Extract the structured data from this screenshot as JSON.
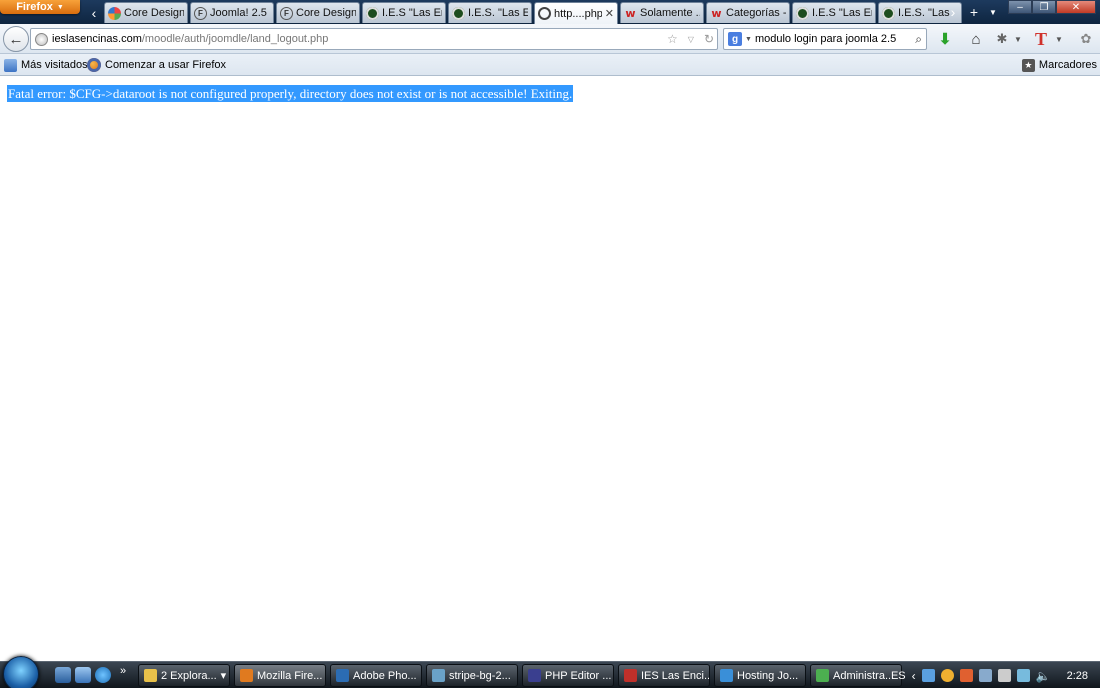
{
  "browser": {
    "menu_button_label": "Firefox",
    "tabs": [
      {
        "label": "Core Design...",
        "favicon": "joomla-icon",
        "active": false
      },
      {
        "label": "Joomla! 2.5 ...",
        "favicon": "f-circle-icon",
        "active": false
      },
      {
        "label": "Core Design...",
        "favicon": "f-circle-icon",
        "active": false
      },
      {
        "label": "I.E.S \"Las En...",
        "favicon": "ies-icon",
        "active": false
      },
      {
        "label": "I.E.S. \"Las E...",
        "favicon": "ies-icon",
        "active": false
      },
      {
        "label": "http....php",
        "favicon": "globe-icon",
        "active": true
      },
      {
        "label": "Solamente ...",
        "favicon": "w-icon",
        "active": false
      },
      {
        "label": "Categorías -...",
        "favicon": "w-icon",
        "active": false
      },
      {
        "label": "I.E.S \"Las En...",
        "favicon": "ies-icon",
        "active": false
      },
      {
        "label": "I.E.S. \"Las",
        "favicon": "ies-icon",
        "active": false
      }
    ],
    "url_domain": "ieslasencinas.com",
    "url_path": "/moodle/auth/joomdle/land_logout.php",
    "search_value": "modulo login para joomla 2.5",
    "bookmarks": {
      "most_visited": "Más visitados",
      "getting_started": "Comenzar a usar Firefox",
      "bookmarks_menu": "Marcadores"
    }
  },
  "page": {
    "error_message": "Fatal error: $CFG->dataroot is not configured properly, directory does not exist or is not accessible! Exiting."
  },
  "taskbar": {
    "buttons": [
      {
        "label": "2 Explora...",
        "icon": "folder-icon",
        "color": "#e8c14a"
      },
      {
        "label": "Mozilla Fire...",
        "icon": "firefox-icon",
        "color": "#e07a1f"
      },
      {
        "label": "Adobe Pho...",
        "icon": "photoshop-icon",
        "color": "#2b6cb3"
      },
      {
        "label": "stripe-bg-2...",
        "icon": "image-icon",
        "color": "#6aa2c8"
      },
      {
        "label": "PHP Editor ...",
        "icon": "php-icon",
        "color": "#3a3f8f"
      },
      {
        "label": "IES Las Enci...",
        "icon": "filezilla-icon",
        "color": "#c0302a"
      },
      {
        "label": "Hosting Jo...",
        "icon": "ie-icon",
        "color": "#3a8fd8"
      },
      {
        "label": "Administra...",
        "icon": "chrome-icon",
        "color": "#4caf50"
      }
    ],
    "language": "ES",
    "clock": "2:28"
  }
}
